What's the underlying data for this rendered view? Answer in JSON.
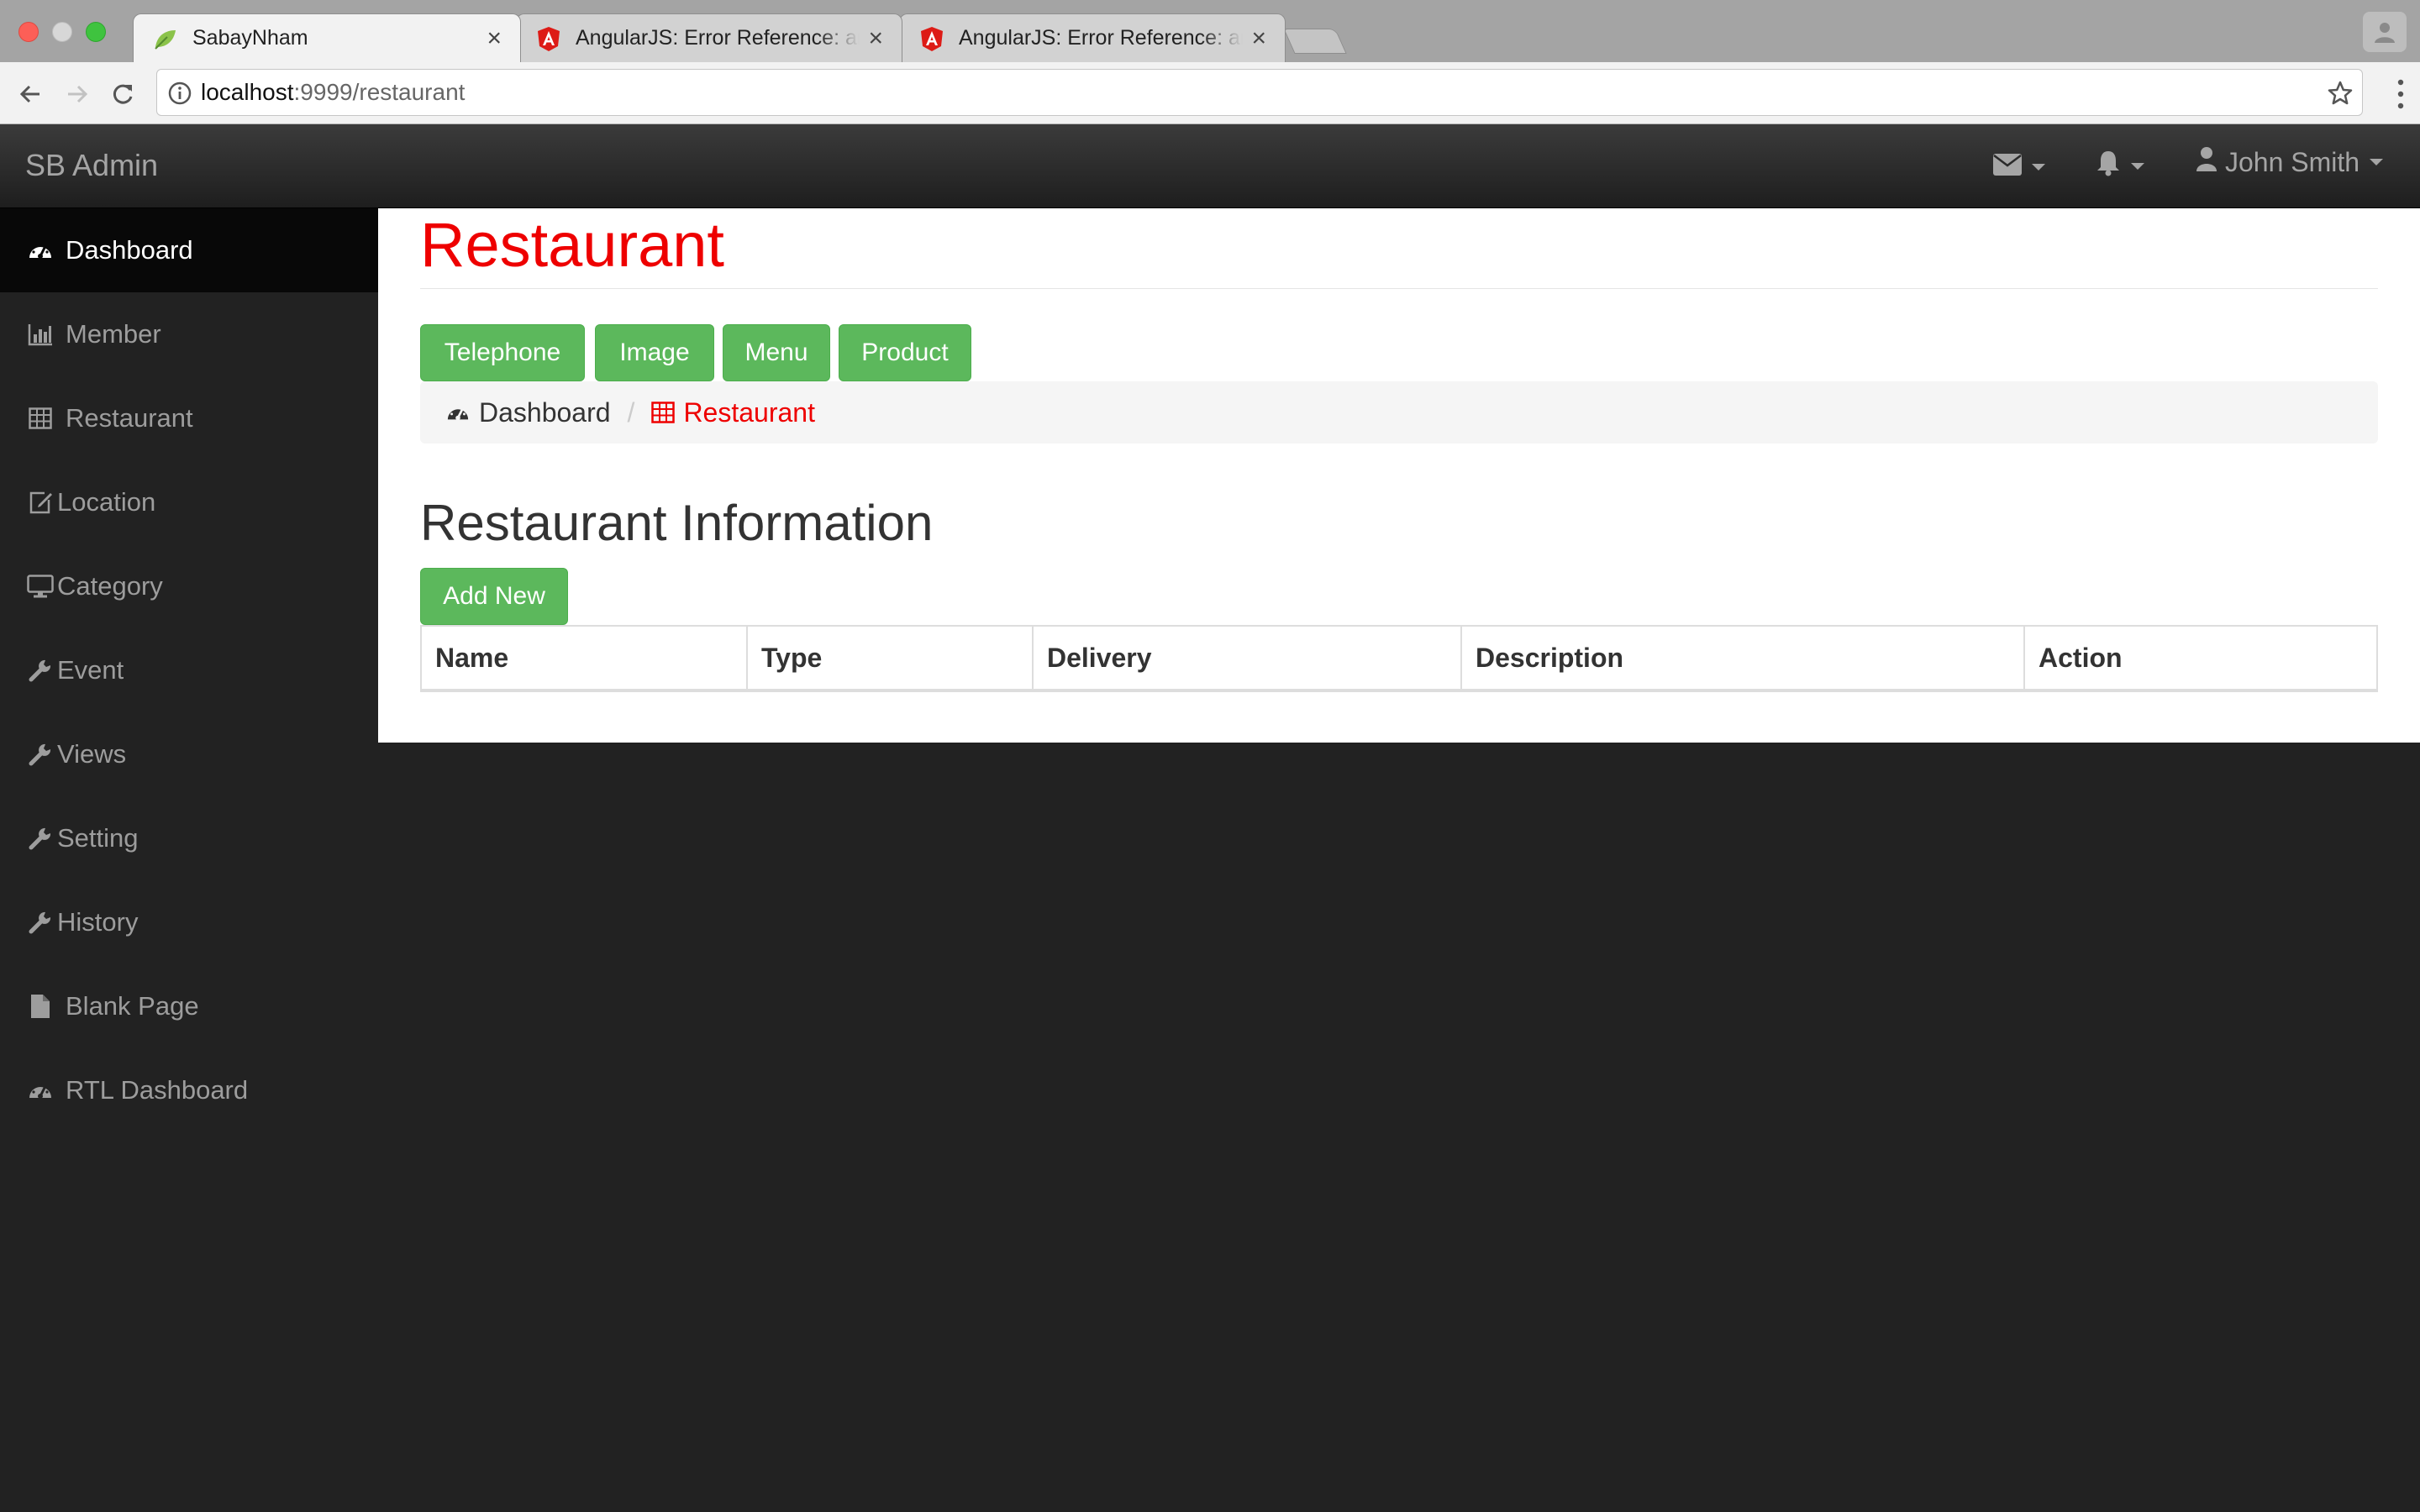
{
  "browser": {
    "tabs": [
      {
        "title": "SabayNham",
        "active": true,
        "favicon": "leaf-icon"
      },
      {
        "title": "AngularJS: Error Reference: ar",
        "active": false,
        "favicon": "angular-icon"
      },
      {
        "title": "AngularJS: Error Reference: ar",
        "active": false,
        "favicon": "angular-icon"
      }
    ],
    "close_glyph": "×",
    "url_host": "localhost",
    "url_path": ":9999/restaurant"
  },
  "navbar": {
    "brand": "SB Admin",
    "user_name": "John Smith",
    "icons": [
      "envelope-icon",
      "bell-icon",
      "user-icon"
    ]
  },
  "sidebar": {
    "items": [
      {
        "label": "Dashboard",
        "icon": "dashboard-icon",
        "active": true
      },
      {
        "label": "Member",
        "icon": "bar-chart-icon"
      },
      {
        "label": "Restaurant",
        "icon": "table-icon"
      },
      {
        "label": "Location",
        "icon": "edit-icon"
      },
      {
        "label": "Category",
        "icon": "desktop-icon"
      },
      {
        "label": "Event",
        "icon": "wrench-icon"
      },
      {
        "label": "Views",
        "icon": "wrench-icon"
      },
      {
        "label": "Setting",
        "icon": "wrench-icon"
      },
      {
        "label": "History",
        "icon": "wrench-icon"
      },
      {
        "label": "Blank Page",
        "icon": "file-icon"
      },
      {
        "label": "RTL Dashboard",
        "icon": "dashboard-icon"
      }
    ]
  },
  "main": {
    "title": "Restaurant",
    "buttons": [
      "Telephone",
      "Image",
      "Menu",
      "Product"
    ],
    "breadcrumb": {
      "home": "Dashboard",
      "separator": "/",
      "current": "Restaurant"
    },
    "section_title": "Restaurant Information",
    "add_button": "Add New",
    "table_headers": [
      "Name",
      "Type",
      "Delivery",
      "Description",
      "Action"
    ]
  },
  "colors": {
    "title_red": "#ee0000",
    "button_green": "#5cb85c",
    "navbar_dark": "#222222"
  }
}
